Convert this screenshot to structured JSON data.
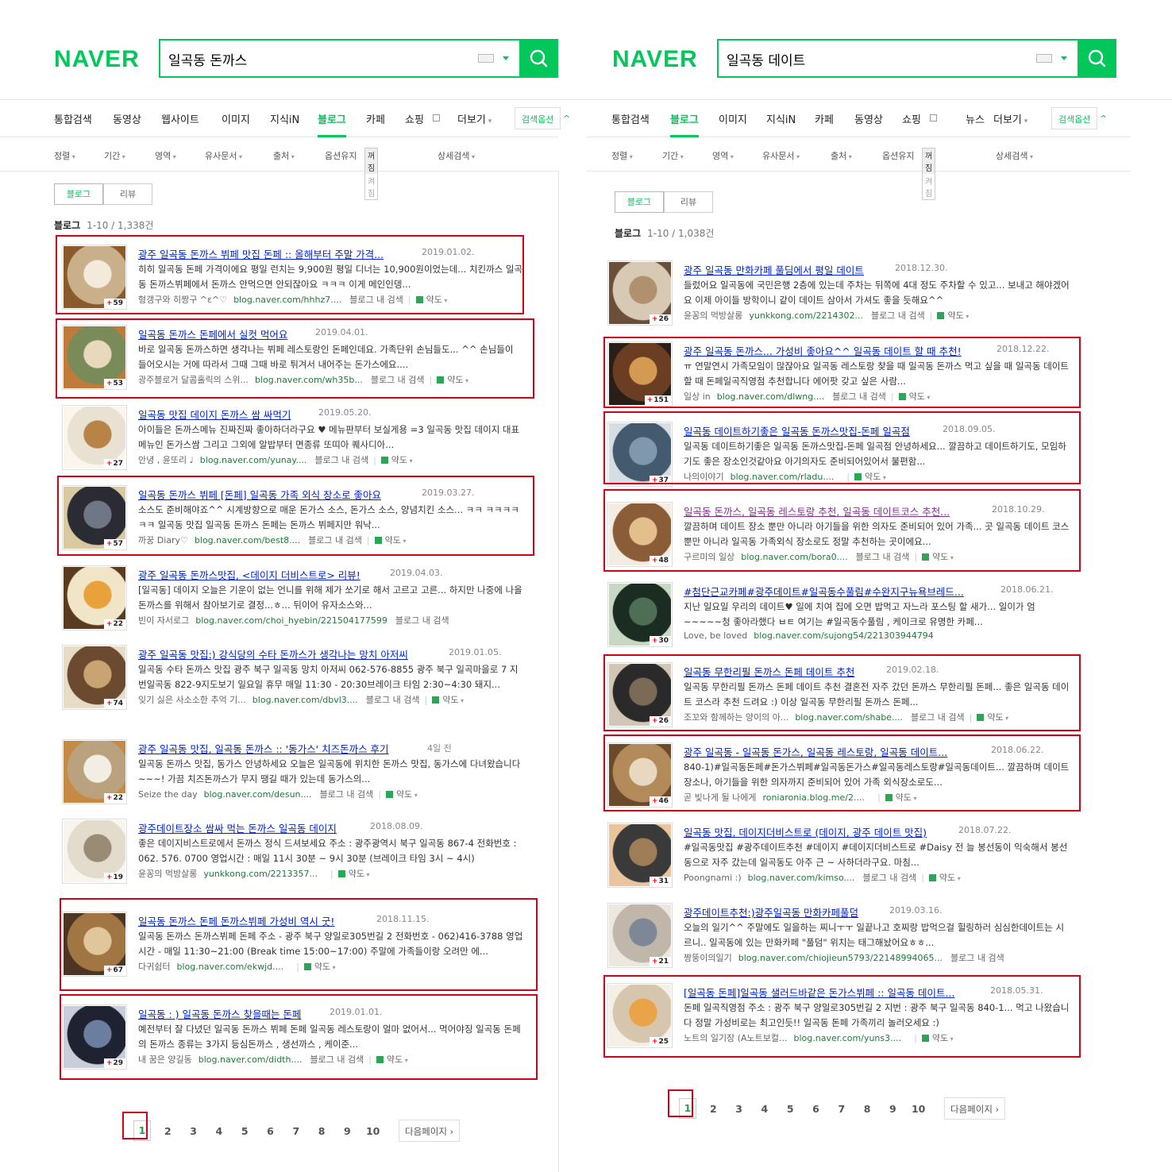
{
  "left": {
    "logo": "NAVER",
    "query": "일곡동 돈까스",
    "tabs": [
      {
        "label": "통합검색"
      },
      {
        "label": "동영상"
      },
      {
        "label": "웹사이트"
      },
      {
        "label": "이미지"
      },
      {
        "label": "지식iN"
      },
      {
        "label": "블로그"
      },
      {
        "label": "카페"
      },
      {
        "label": "쇼핑"
      },
      {
        "label": "더보기"
      }
    ],
    "search_option": "검색옵션",
    "filters": [
      "정렬",
      "기간",
      "영역",
      "유사문서",
      "출처",
      "옵션유지",
      "상세검색"
    ],
    "toggle": [
      "꺼짐",
      "켜짐"
    ],
    "subtabs": [
      "블로그",
      "리뷰"
    ],
    "count_label": "블로그",
    "count_text": "1-10 / 1,338건",
    "results": [
      {
        "title": "광주 일곡동 돈까스 뷔페 맛집 돈페 :: 올해부터 주말 가격...",
        "date": "2019.01.02.",
        "desc": "히히 일곡동 돈페 가격이에요 평일 런치는 9,900원 평일 디너는 10,900원이었는데... 치킨까스 일곡동 돈까스뷔페에서 돈까스 안먹으면 안되잖아요 ㅋㅋㅋ 이게 메인인뎅...",
        "source": "형갱구와 히짱구 ^ε^♡",
        "url": "blog.naver.com/hhhz7....",
        "blog_search": "블로그 내 검색",
        "map": "약도",
        "count": "59"
      },
      {
        "title": "일곡동 돈까스 돈페에서 실컷 먹어요",
        "date": "2019.04.01.",
        "desc": "바로 일곡동 돈까스하면 생각나는 뷔페 레스토랑인 돈페인데요. 가족단위 손님들도... ^^ 손님들이 들어오시는 거에 따라서 그때 그때 바로 튀겨서 내어주는 돈가스에요....",
        "source": "광주블로거 달콤홀릭의 스위...",
        "url": "blog.naver.com/wh35b...",
        "blog_search": "블로그 내 검색",
        "map": "약도",
        "count": "53"
      },
      {
        "title": "일곡동 맛집 데이지 돈까스 쌈 싸먹기",
        "date": "2019.05.20.",
        "desc": "아이들은 돈까스메뉴 진짜진짜 좋아하더라구요 ♥ 메뉴판부터 보실게용 =3 일곡동 맛집 데이지 대표메뉴인 돈가스쌈 그리고 그외에 알밥부터 면종류 또띠아 퀘사디아...",
        "source": "안녕 , 윤또리 ♩",
        "url": "blog.naver.com/yunay....",
        "blog_search": "블로그 내 검색",
        "map": "약도",
        "count": "27"
      },
      {
        "title": "일곡동 돈까스 뷔페 [돈페] 일곡동 가족 외식 장소로 좋아요",
        "date": "2019.03.27.",
        "desc": "소스도 준비해야죠^^ 시계방향으로 매운 돈가스 소스, 돈가스 소스, 양념치킨 소스... ㅋㅋ ㅋㅋㅋㅋㅋㅋ 일곡동 맛집 일곡동 돈까스 돈페는 돈까스 뷔페지만 워낙...",
        "source": "까꿍 Diary♡",
        "url": "blog.naver.com/best8....",
        "blog_search": "블로그 내 검색",
        "map": "약도",
        "count": "57"
      },
      {
        "title": "광주 일곡동 돈까스맛집, <데이지 더비스트로> 리뷰!",
        "date": "2019.04.03.",
        "desc": "[일곡동] 데이지 오늘은 기운이 없는 언니를 위해 제가 쏘기로 해서 고르고 고른... 하지만 나중에 나올 돈까스를 위해서 참아보기로 결정...ㅎ... 뒤이어 유자소스와...",
        "source": "빈이 자서로그",
        "url": "blog.naver.com/choi_hyebin/221504177599",
        "blog_search": "블로그 내 검색",
        "map": "",
        "count": "22"
      },
      {
        "title": "광주 일곡동 맛집:) 강식당의 수타 돈까스가 생각나는 망치 아저씨",
        "date": "2019.01.05.",
        "desc": "일곡동 수타 돈까스 맛집 광주 북구 일곡동 망치 아저씨 062-576-8855 광주 북구 일곡마을로 7 지번일곡동 822-9지도보기 일요일 휴무 매일 11:30 - 20:30브레이크 타임 2:30~4:30 돼지...",
        "source": "잊기 싫은 사소소한 추억 기...",
        "url": "blog.naver.com/dbvl3....",
        "blog_search": "블로그 내 검색",
        "map": "약도",
        "count": "74"
      },
      {
        "title": "광주 일곡동 맛집, 일곡동 돈까스 :: '동가스' 치즈돈까스 후기",
        "date": "4일 전",
        "desc": "일곡동 돈까스 맛집, 동가스 안녕하세요 오늘은 일곡동에 위치한 돈까스 맛집, 동가스에 다녀왔습니다~~~! 가끔 치즈돈까스가 무지 땡길 때가 있는데 동가스의...",
        "source": "Seize the day",
        "url": "blog.naver.com/desun....",
        "blog_search": "블로그 내 검색",
        "map": "약도",
        "count": "22"
      },
      {
        "title": "광주데이트장소 쌈싸 먹는 돈까스 일곡동 데이지",
        "date": "2018.08.09.",
        "desc": "좋은 데이지비스트로에서 돈까스 정식 드셔보세요 주소 : 광주광역시 북구 일곡동 867-4 전화번호 : 062. 576. 0700 영업시간 : 매일 11시 30분 ~ 9시 30분 (브레이크 타임 3시 ~ 4시)",
        "source": "윤꽁의 먹방살롱",
        "url": "yunkkong.com/2213357...",
        "blog_search": "",
        "map": "약도",
        "count": "19"
      },
      {
        "title": "일곡동 돈까스 돈페 돈까스뷔페 가성비 역시 굿!",
        "date": "2018.11.15.",
        "desc": "일곡동 돈까스 돈까스뷔페 돈페 주소 - 광주 북구 양일로305번길 2 전화번호 - 062)416-3788 영업시간 - 매일 11:30~21:00 (Break time 15:00~17:00) 주말에 가족들이랑 오려만 에...",
        "source": "다귀쉼터",
        "url": "blog.naver.com/ekwjd....",
        "blog_search": "",
        "map": "약도",
        "count": "67"
      },
      {
        "title": "일곡동 : ) 일곡동 돈까스 찾을때는 돈페",
        "date": "2019.01.01.",
        "desc": "예전부터 잘 다녔던 일곡동 돈까스 뷔페 돈페 일곡동 레스토랑이 얼마 없어서... 먹어야징 일곡동 돈페의 돈까스 종류는 3가지 등심돈까스 , 생선까스 , 케이준...",
        "source": "내 꿈은 양길동",
        "url": "blog.naver.com/didth....",
        "blog_search": "블로그 내 검색",
        "map": "약도",
        "count": "29"
      }
    ],
    "pages": [
      "1",
      "2",
      "3",
      "4",
      "5",
      "6",
      "7",
      "8",
      "9",
      "10"
    ],
    "next": "다음페이지"
  },
  "right": {
    "logo": "NAVER",
    "query": "일곡동 데이트",
    "tabs": [
      {
        "label": "통합검색"
      },
      {
        "label": "블로그"
      },
      {
        "label": "이미지"
      },
      {
        "label": "지식iN"
      },
      {
        "label": "카페"
      },
      {
        "label": "동영상"
      },
      {
        "label": "쇼핑"
      },
      {
        "label": "뉴스"
      },
      {
        "label": "더보기"
      }
    ],
    "search_option": "검색옵션",
    "filters": [
      "정렬",
      "기간",
      "영역",
      "유사문서",
      "출처",
      "옵션유지",
      "상세검색"
    ],
    "toggle": [
      "꺼짐",
      "켜짐"
    ],
    "subtabs": [
      "블로그",
      "리뷰"
    ],
    "count_label": "블로그",
    "count_text": "1-10 / 1,038건",
    "results": [
      {
        "title": "광주 일곡동 만화카페 풀딤에서 평일 데이트",
        "date": "2018.12.30.",
        "desc": "들렀어요 일곡동에 국민은행 2층에 있는데 주차는 뒤쪽에 4대 정도 주차할 수 있고... 보내고 해야겠어요 이제 아이들 방학이니 같이 데이트 삼아서 가셔도 좋을 듯해요^^",
        "source": "윤꽁의 먹방살롱",
        "url": "yunkkong.com/2214302...",
        "blog_search": "블로그 내 검색",
        "map": "약도",
        "count": "26"
      },
      {
        "title": "광주 일곡동 돈까스... 가성비 좋아요^^ 일곡동 데이트 할 때 추천!",
        "date": "2018.12.22.",
        "desc": "ㅠ 연말연시 가족모임이 많잖아요 일곡동 레스토랑 찾을 때 일곡동 돈까스 먹고 싶을 때 일곡동 데이트 할 때 돈페일곡직영점 추천합니다 에어팟 갖고 싶은 사람...",
        "source": "일상 in",
        "url": "blog.naver.com/dlwng....",
        "blog_search": "블로그 내 검색",
        "map": "약도",
        "count": "151"
      },
      {
        "title": "일곡동 데이트하기좋은 일곡동 돈까스맛집-돈페 일곡점",
        "date": "2018.09.05.",
        "desc": "일곡동 데이트하기좋은 일곡동 돈까스맛집-돈페 일곡점 안녕하세요... 깔끔하고 데이트하기도, 모임하기도 좋은 장소인것같아요 아기의자도 준비되어있어서 불편함...",
        "source": "나의이야기",
        "url": "blog.naver.com/rladu....",
        "blog_search": "",
        "map": "약도",
        "count": "37"
      },
      {
        "title": "일곡동 돈까스, 일곡동 레스토랑 추천, 일곡동 데이트코스 추천...",
        "date": "2018.10.29.",
        "desc": "깔끔하며 데이트 장소 뿐만 아니라 아기들을 위한 의자도 준비되어 있어 가족... 곳 일곡동 데이트 코스 뿐만 아니라 일곡동 가족외식 장소로도 정말 추천하는 곳이에요...",
        "source": "구르미의 일상",
        "url": "blog.naver.com/bora0....",
        "blog_search": "블로그 내 검색",
        "map": "약도",
        "count": "48"
      },
      {
        "title": "#첨단근교카페#광주데이트#일곡동수풀림#수완지구뉴욕브레드...",
        "date": "2018.06.21.",
        "desc": "지난 일요일 우리의 데이트♥ 일에 치여 집에 오면 밥먹고 자느라 포스팅 할 새가... 일이가 엄~~~~~청 좋아라했다 ㅂㅌ 여기는 #일곡동수풀림 , 케이크로 유명한 카페...",
        "source": "Love, be loved",
        "url": "blog.naver.com/sujong54/221303944794",
        "blog_search": "",
        "map": "",
        "count": "30"
      },
      {
        "title": "일곡동 무한리필 돈까스 돈페 데이트 추천",
        "date": "2019.02.18.",
        "desc": "일곡동 무한리필 돈까스 돈페 데이트 추천 결혼전 자주 갔던 돈까스 무한리필 돈페... 좋은 일곡동 데이트 코스라 추천 드려요 :) 이상 일곡동 무한리필 돈까스 돈페...",
        "source": "조꼬와 함께하는 양이의 아...",
        "url": "blog.naver.com/shabe....",
        "blog_search": "블로그 내 검색",
        "map": "약도",
        "count": "26"
      },
      {
        "title": "광주 일곡동 - 일곡동 돈가스, 일곡동 레스토랑, 일곡동 데이트...",
        "date": "2018.06.22.",
        "desc": "840-1)#일곡동돈페#돈가스뷔페#일곡동돈가스#일곡동레스토랑#일곡동데이트... 깔끔하며 데이트 장소나, 아기들을 위한 의자까지 준비되어 있어 가족 외식장소로도...",
        "source": "곧 빛나게 될 나에게",
        "url": "roniaronia.blog.me/2....",
        "blog_search": "",
        "map": "약도",
        "count": "46"
      },
      {
        "title": "일곡동 맛집, 데이지더비스트로 (데이지, 광주 데이트 맛집)",
        "date": "2018.07.22.",
        "desc": "#일곡동맛집 #광주데이트추천 #데이지 #데이지더비스트로 #Daisy 전 늘 봉선동이 익숙해서 봉선동으로 자주 갔는데 일곡동도 아주 근 ~ 사하더라구요. 마침...",
        "source": "Poongnami :)",
        "url": "blog.naver.com/kimso....",
        "blog_search": "블로그 내 검색",
        "map": "약도",
        "count": "31"
      },
      {
        "title": "광주데이트추천:)광주일곡동 만화카페풀덤",
        "date": "2019.03.16.",
        "desc": "오늘의 일기^^ 주말에도 일을하는 찌니ㅜㅜ 일끝나고 호찌랑 밥먹으걸 힐링하러 심심한데이트는 시르니.. 일곡동에 있는 만화카페 \"풀덤\" 위치는 태그해놨어요ㅎㅎ...",
        "source": "짱뚱이의일기",
        "url": "blog.naver.com/chiojieun5793/22148994065...",
        "blog_search": "블로그 내 검색",
        "map": "",
        "count": "21"
      },
      {
        "title": "[일곡동 돈페]일곡동 샐러드바같은 돈가스뷔페 :: 일곡동 데이트...",
        "date": "2018.05.31.",
        "desc": "돈페 일곡직영점 주소 : 광주 북구 양일로305번길 2 지번 : 광주 북구 일곡동 840-1... 먹고 나왔습니다 정말 가성비로는 최고인듯!! 일곡동 돈페 가족끼리 놀러오세요 :)",
        "source": "노트의 일기장 (A노트보컬...",
        "url": "blog.naver.com/yuns3....",
        "blog_search": "",
        "map": "약도",
        "count": "25"
      }
    ],
    "pages": [
      "1",
      "2",
      "3",
      "4",
      "5",
      "6",
      "7",
      "8",
      "9",
      "10"
    ],
    "next": "다음페이지"
  },
  "colors": {
    "naver_green": "#03c75a",
    "link": "#0022cc",
    "visited": "#83328e",
    "highlight": "#d0021b"
  }
}
